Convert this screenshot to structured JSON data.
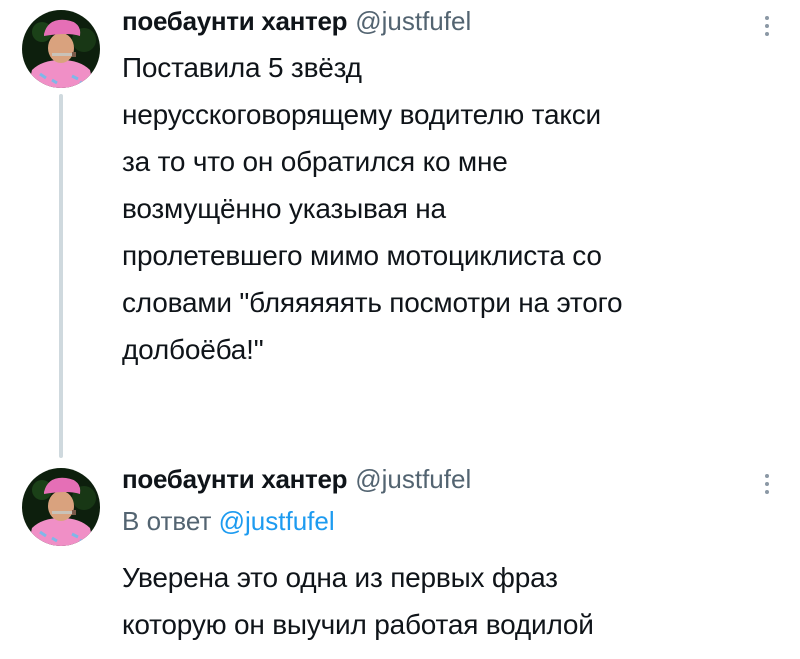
{
  "colors": {
    "text": "#0f1419",
    "secondary": "#536471",
    "link": "#1d9bf0",
    "thread_line": "#cfd9de"
  },
  "tweets": [
    {
      "display_name": "поебаунти хантер",
      "handle": "@justfufel",
      "text": "Поставила 5 звёзд\nнерусскоговорящему водителю такси\nза то что он обратился ко мне\nвозмущённо указывая на\nпролетевшего мимо мотоциклиста со\nсловами \"бляяяяять посмотри на этого\nдолбоёба!\"",
      "avatar_icon": "profile-photo-pink-beret",
      "menu_icon": "more-vertical-icon"
    },
    {
      "display_name": "поебаунти хантер",
      "handle": "@justfufel",
      "reply_prefix": "В ответ",
      "reply_mention": "@justfufel",
      "text": "Уверена это одна из первых фраз\nкоторую он выучил работая водилой",
      "avatar_icon": "profile-photo-pink-beret",
      "menu_icon": "more-vertical-icon"
    }
  ]
}
